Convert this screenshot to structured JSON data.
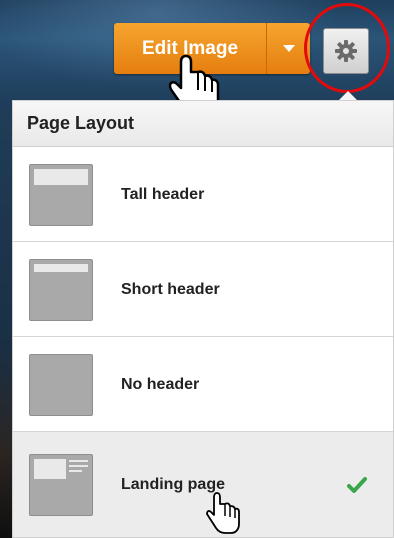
{
  "toolbar": {
    "edit_image_label": "Edit Image",
    "dropdown_icon": "caret-down",
    "settings_icon": "gear"
  },
  "panel": {
    "title": "Page Layout",
    "items": [
      {
        "label": "Tall header",
        "thumbnail_icon": "tall-header-layout",
        "selected": false
      },
      {
        "label": "Short header",
        "thumbnail_icon": "short-header-layout",
        "selected": false
      },
      {
        "label": "No header",
        "thumbnail_icon": "no-header-layout",
        "selected": false
      },
      {
        "label": "Landing page",
        "thumbnail_icon": "landing-page-layout",
        "selected": true
      }
    ]
  },
  "colors": {
    "accent_orange": "#f08f1f",
    "highlight_red": "#e20a0a",
    "check_green": "#3aa64a",
    "background_blue": "#244a6b"
  }
}
